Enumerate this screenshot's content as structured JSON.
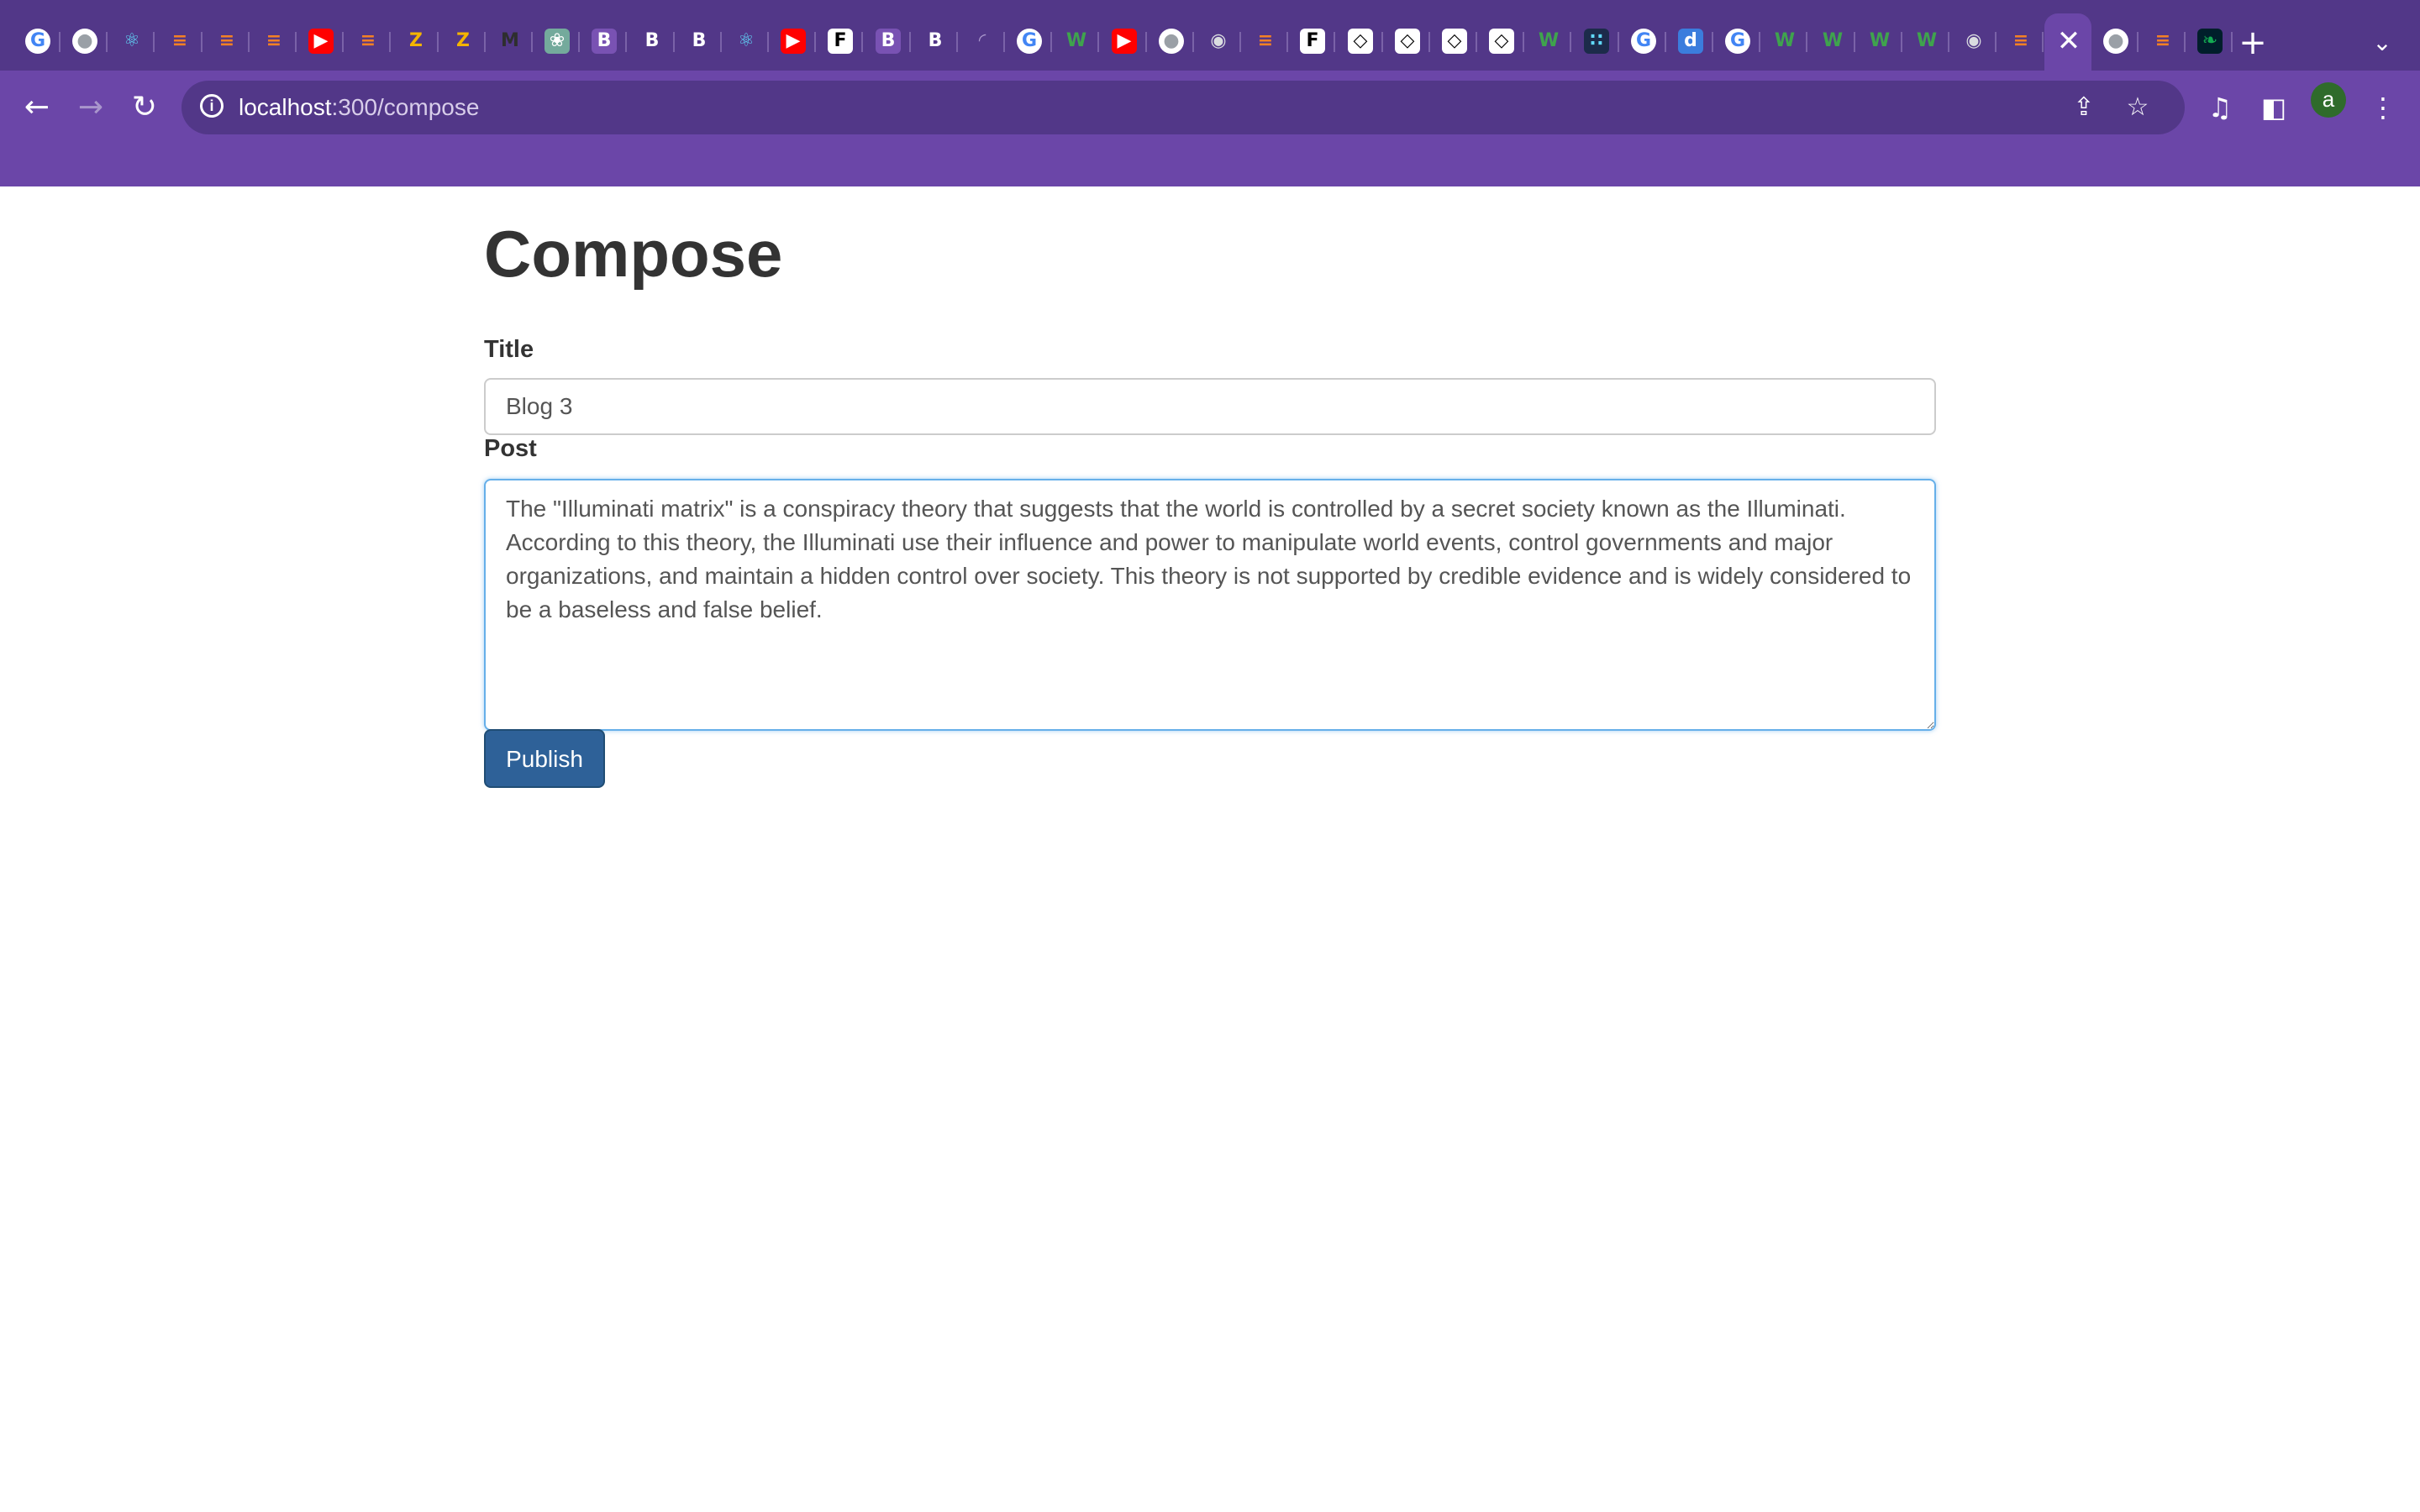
{
  "browser": {
    "tabs": [
      {
        "icon": "google-icon",
        "glyph": "G",
        "fg": "#4285f4",
        "bg": "#ffffff"
      },
      {
        "icon": "globe-icon",
        "glyph": "●",
        "fg": "#9aa0a6",
        "bg": "#ffffff"
      },
      {
        "icon": "react-icon",
        "glyph": "⚛",
        "fg": "#61dafb",
        "bg": "transparent"
      },
      {
        "icon": "stackoverflow-icon",
        "glyph": "≡",
        "fg": "#f48024",
        "bg": "transparent"
      },
      {
        "icon": "stackoverflow-icon",
        "glyph": "≡",
        "fg": "#f48024",
        "bg": "transparent"
      },
      {
        "icon": "stackoverflow-icon",
        "glyph": "≡",
        "fg": "#f48024",
        "bg": "transparent"
      },
      {
        "icon": "youtube-icon",
        "glyph": "▶",
        "fg": "#ffffff",
        "bg": "#ff0000"
      },
      {
        "icon": "stackoverflow-icon",
        "glyph": "≡",
        "fg": "#f48024",
        "bg": "transparent"
      },
      {
        "icon": "zb-icon",
        "glyph": "Z",
        "fg": "#f4b400",
        "bg": "transparent"
      },
      {
        "icon": "zb-icon",
        "glyph": "Z",
        "fg": "#f4b400",
        "bg": "transparent"
      },
      {
        "icon": "m-icon",
        "glyph": "M",
        "fg": "#2e2e2e",
        "bg": "transparent"
      },
      {
        "icon": "chatgpt-icon",
        "glyph": "❀",
        "fg": "#ffffff",
        "bg": "#74aa9c"
      },
      {
        "icon": "bootstrap-icon",
        "glyph": "B",
        "fg": "#ffffff",
        "bg": "#7952b3"
      },
      {
        "icon": "b-icon",
        "glyph": "B",
        "fg": "#ffffff",
        "bg": "transparent"
      },
      {
        "icon": "b-icon",
        "glyph": "B",
        "fg": "#ffffff",
        "bg": "transparent"
      },
      {
        "icon": "react-icon",
        "glyph": "⚛",
        "fg": "#61dafb",
        "bg": "transparent"
      },
      {
        "icon": "youtube-icon",
        "glyph": "▶",
        "fg": "#ffffff",
        "bg": "#ff0000"
      },
      {
        "icon": "f-icon",
        "glyph": "F",
        "fg": "#000000",
        "bg": "#ffffff"
      },
      {
        "icon": "bootstrap-icon",
        "glyph": "B",
        "fg": "#ffffff",
        "bg": "#7952b3"
      },
      {
        "icon": "b-icon",
        "glyph": "B",
        "fg": "#ffffff",
        "bg": "transparent"
      },
      {
        "icon": "loading-icon",
        "glyph": "◜",
        "fg": "#a996cc",
        "bg": "transparent"
      },
      {
        "icon": "google-icon",
        "glyph": "G",
        "fg": "#4285f4",
        "bg": "#ffffff"
      },
      {
        "icon": "w-icon",
        "glyph": "W",
        "fg": "#3fa34d",
        "bg": "transparent"
      },
      {
        "icon": "youtube-icon",
        "glyph": "▶",
        "fg": "#ffffff",
        "bg": "#ff0000"
      },
      {
        "icon": "globe-icon",
        "glyph": "●",
        "fg": "#9aa0a6",
        "bg": "#ffffff"
      },
      {
        "icon": "chrome-icon",
        "glyph": "◉",
        "fg": "#dadce0",
        "bg": "transparent"
      },
      {
        "icon": "stackoverflow-icon",
        "glyph": "≡",
        "fg": "#f48024",
        "bg": "transparent"
      },
      {
        "icon": "f-icon",
        "glyph": "F",
        "fg": "#000000",
        "bg": "#ffffff"
      },
      {
        "icon": "codepen-icon",
        "glyph": "◇",
        "fg": "#000000",
        "bg": "#ffffff"
      },
      {
        "icon": "codepen-icon",
        "glyph": "◇",
        "fg": "#000000",
        "bg": "#ffffff"
      },
      {
        "icon": "codepen-icon",
        "glyph": "◇",
        "fg": "#000000",
        "bg": "#ffffff"
      },
      {
        "icon": "codepen-icon",
        "glyph": "◇",
        "fg": "#000000",
        "bg": "#ffffff"
      },
      {
        "icon": "w-icon",
        "glyph": "W",
        "fg": "#3fa34d",
        "bg": "transparent"
      },
      {
        "icon": "grid-icon",
        "glyph": "∷",
        "fg": "#61dafb",
        "bg": "#1c2b4a"
      },
      {
        "icon": "google-icon",
        "glyph": "G",
        "fg": "#4285f4",
        "bg": "#ffffff"
      },
      {
        "icon": "d-icon",
        "glyph": "d",
        "fg": "#ffffff",
        "bg": "#3b7ddd"
      },
      {
        "icon": "google-icon",
        "glyph": "G",
        "fg": "#4285f4",
        "bg": "#ffffff"
      },
      {
        "icon": "w-icon",
        "glyph": "W",
        "fg": "#3fa34d",
        "bg": "transparent"
      },
      {
        "icon": "w-icon",
        "glyph": "W",
        "fg": "#3fa34d",
        "bg": "transparent"
      },
      {
        "icon": "w-icon",
        "glyph": "W",
        "fg": "#3fa34d",
        "bg": "transparent"
      },
      {
        "icon": "w-icon",
        "glyph": "W",
        "fg": "#3fa34d",
        "bg": "transparent"
      },
      {
        "icon": "chrome-icon",
        "glyph": "◉",
        "fg": "#dadce0",
        "bg": "transparent"
      },
      {
        "icon": "stackoverflow-icon",
        "glyph": "≡",
        "fg": "#f48024",
        "bg": "transparent"
      },
      {
        "icon": "close-icon",
        "glyph": "✕",
        "fg": "#ffffff",
        "bg": "transparent",
        "active": true
      },
      {
        "icon": "globe-icon",
        "glyph": "●",
        "fg": "#9aa0a6",
        "bg": "#ffffff"
      },
      {
        "icon": "stackoverflow-icon",
        "glyph": "≡",
        "fg": "#f48024",
        "bg": "transparent"
      },
      {
        "icon": "mongodb-icon",
        "glyph": "❧",
        "fg": "#13aa52",
        "bg": "#001e2b"
      }
    ],
    "new_tab_icon": "plus-icon",
    "new_tab_glyph": "+",
    "tab_search_glyph": "⌄",
    "url_host": "localhost",
    "url_path": ":300/compose",
    "back_glyph": "←",
    "forward_glyph": "→",
    "reload_glyph": "↻",
    "info_glyph": "i",
    "share_glyph": "⇪",
    "bookmark_glyph": "☆",
    "media_glyph": "♫",
    "sidepanel_glyph": "◧",
    "menu_glyph": "⋮",
    "avatar_letter": "a",
    "colors": {
      "tabstrip": "#523788",
      "toolbar": "#6b46a8",
      "avatar": "#2f6b2b"
    }
  },
  "page": {
    "title": "Compose",
    "form": {
      "title_label": "Title",
      "title_value": "Blog 3",
      "post_label": "Post",
      "post_value": "The \"Illuminati matrix\" is a conspiracy theory that suggests that the world is controlled by a secret society known as the Illuminati. According to this theory, the Illuminati use their influence and power to manipulate world events, control governments and major organizations, and maintain a hidden control over society. This theory is not supported by credible evidence and is widely considered to be a baseless and false belief.",
      "publish_label": "Publish"
    },
    "colors": {
      "publish_button": "#2e6198",
      "focus_border": "#66afe9",
      "text": "#333333"
    }
  }
}
